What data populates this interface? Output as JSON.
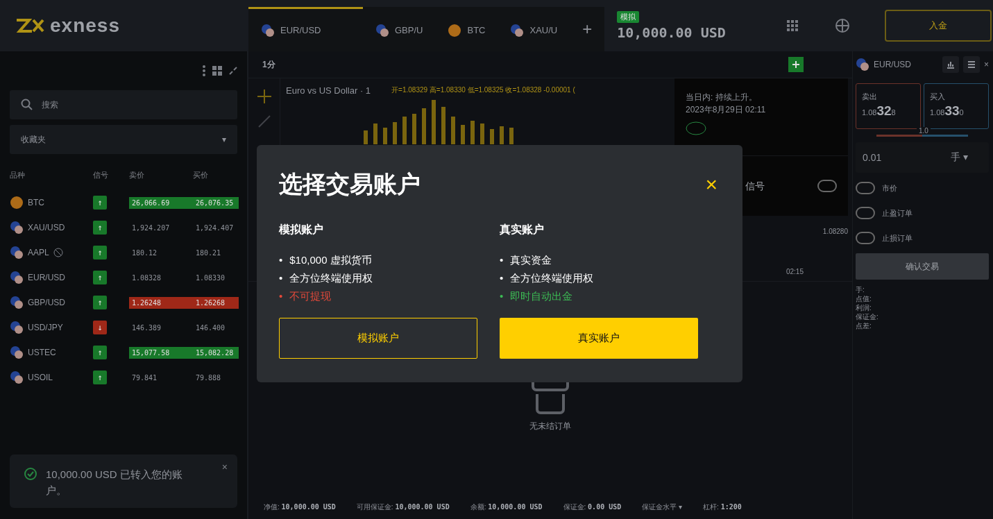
{
  "logo": {
    "text": "exness"
  },
  "tabs": [
    {
      "label": "EUR/USD",
      "kind": "currency",
      "selected": true
    },
    {
      "label": "GBP/U",
      "kind": "currency",
      "selected": false
    },
    {
      "label": "BTC",
      "kind": "crypto",
      "selected": false
    },
    {
      "label": "XAU/U",
      "kind": "currency",
      "selected": false
    }
  ],
  "add_tab": "+",
  "account": {
    "badge": "模拟",
    "balance": "10,000.00 USD"
  },
  "deposit_button": "入金",
  "sidebar": {
    "search": {
      "placeholder": "搜索"
    },
    "filter": "收藏夹",
    "filter_caret": "▾",
    "columns": [
      "品种",
      "信号",
      "卖价",
      "买价"
    ],
    "rows": [
      {
        "symbol": "BTC",
        "signal": "↑",
        "kind": "rising",
        "bid": "26,066.69",
        "ask": "26,076.35"
      },
      {
        "symbol": "XAU/USD",
        "signal": "↑",
        "kind": "steady",
        "bid": "1,924.207",
        "ask": "1,924.407"
      },
      {
        "symbol": "AAPL",
        "signal": "↑",
        "kind": "steady",
        "bid": "180.12",
        "ask": "180.21",
        "closed": true
      },
      {
        "symbol": "EUR/USD",
        "signal": "↑",
        "kind": "steady",
        "bid": "1.08328",
        "ask": "1.08330"
      },
      {
        "symbol": "GBP/USD",
        "signal": "↑",
        "kind": "falling",
        "bid": "1.26248",
        "ask": "1.26268"
      },
      {
        "symbol": "USD/JPY",
        "signal": "↓",
        "kind": "steady",
        "bid": "146.389",
        "ask": "146.400"
      },
      {
        "symbol": "USTEC",
        "signal": "↑",
        "kind": "rising",
        "bid": "15,077.58",
        "ask": "15,082.28"
      },
      {
        "symbol": "USOIL",
        "signal": "↑",
        "kind": "steady",
        "bid": "79.841",
        "ask": "79.888"
      }
    ],
    "notification": "10,000.00 USD 已转入您的账户。",
    "notification_close": "×"
  },
  "chart": {
    "timeframe": "1分",
    "title": "Euro vs US Dollar · 1",
    "ohlc": "开=1.08329 高=1.08330 低=1.08325 收=1.08328 -0.00001 (",
    "price_label": "1.08280",
    "time_label": "02:15"
  },
  "signal_popup": {
    "text": "当日内: 持续上升。",
    "date": "2023年8月29日 02:11",
    "label": "信号",
    "on": false
  },
  "orders": {
    "empty": "无未结订单"
  },
  "trade_panel": {
    "symbol": "EUR/USD",
    "close": "×",
    "sell": {
      "label": "卖出",
      "big": "1.08",
      "main": "32",
      "sup": "8"
    },
    "buy": {
      "label": "买入",
      "big": "1.08",
      "main": "33",
      "sup": "0"
    },
    "spread": "1.0",
    "volume": "0.01",
    "unit": "手",
    "unit_caret": "▾",
    "toggles": [
      {
        "label": "市价",
        "on": false
      },
      {
        "label": "止盈订单",
        "on": false
      },
      {
        "label": "止损订单",
        "on": false
      }
    ],
    "confirm": "确认交易",
    "details": [
      "手:",
      "点值:",
      "利润:",
      "保证金:",
      "点差:"
    ]
  },
  "status_bar": [
    {
      "label": "净值:",
      "value": "10,000.00 USD"
    },
    {
      "label": "可用保证金:",
      "value": "10,000.00 USD"
    },
    {
      "label": "余额:",
      "value": "10,000.00 USD"
    },
    {
      "label": "保证金:",
      "value": "0.00 USD"
    },
    {
      "label": "保证金水平 ▾"
    },
    {
      "label": "杠杆:",
      "value": "1:200"
    }
  ],
  "modal": {
    "title": "选择交易账户",
    "close": "×",
    "bullet": "•",
    "accounts": [
      {
        "title": "模拟账户",
        "features": [
          {
            "text": "$10,000 虚拟货币",
            "color": "#ffffff"
          },
          {
            "text": "全方位终端使用权",
            "color": "#ffffff"
          },
          {
            "text": "不可提现",
            "color": "#e5493a"
          }
        ],
        "button": "模拟账户",
        "kind": "outline"
      },
      {
        "title": "真实账户",
        "features": [
          {
            "text": "真实资金",
            "color": "#ffffff"
          },
          {
            "text": "全方位终端使用权",
            "color": "#ffffff"
          },
          {
            "text": "即时自动出金",
            "color": "#3cba54"
          }
        ],
        "button": "真实账户",
        "kind": "primary"
      }
    ]
  }
}
